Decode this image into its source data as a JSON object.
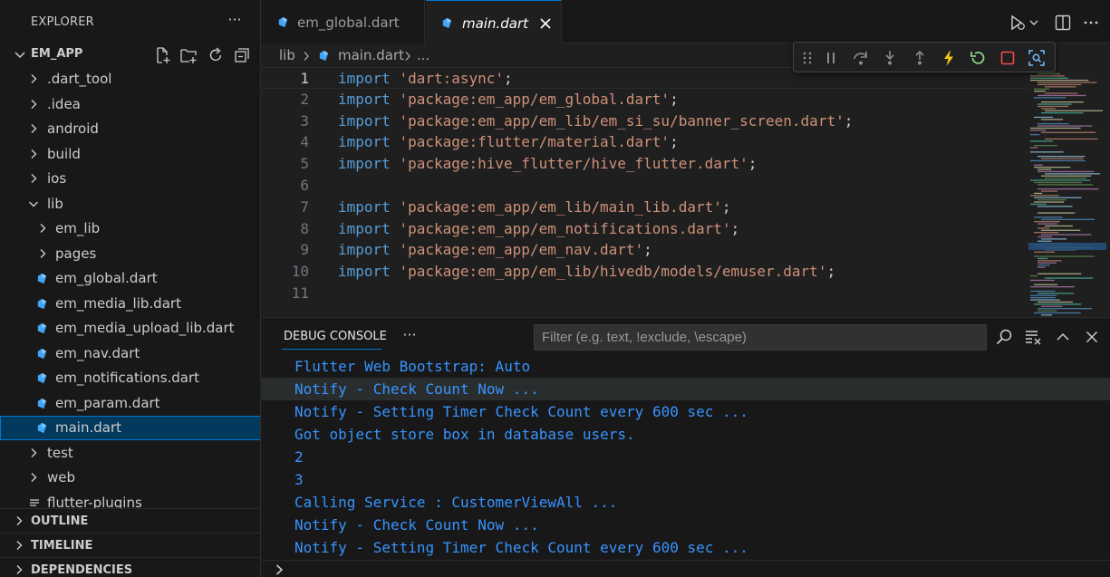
{
  "sidebar": {
    "title": "EXPLORER",
    "more": "···",
    "project": "EM_APP",
    "tree": [
      {
        "label": ".dart_tool",
        "kind": "folder",
        "expanded": false,
        "depth": 0
      },
      {
        "label": ".idea",
        "kind": "folder",
        "expanded": false,
        "depth": 0
      },
      {
        "label": "android",
        "kind": "folder",
        "expanded": false,
        "depth": 0
      },
      {
        "label": "build",
        "kind": "folder",
        "expanded": false,
        "depth": 0
      },
      {
        "label": "ios",
        "kind": "folder",
        "expanded": false,
        "depth": 0
      },
      {
        "label": "lib",
        "kind": "folder",
        "expanded": true,
        "depth": 0
      },
      {
        "label": "em_lib",
        "kind": "folder",
        "expanded": false,
        "depth": 1
      },
      {
        "label": "pages",
        "kind": "folder",
        "expanded": false,
        "depth": 1
      },
      {
        "label": "em_global.dart",
        "kind": "dart",
        "depth": 1
      },
      {
        "label": "em_media_lib.dart",
        "kind": "dart",
        "depth": 1
      },
      {
        "label": "em_media_upload_lib.dart",
        "kind": "dart",
        "depth": 1
      },
      {
        "label": "em_nav.dart",
        "kind": "dart",
        "depth": 1
      },
      {
        "label": "em_notifications.dart",
        "kind": "dart",
        "depth": 1
      },
      {
        "label": "em_param.dart",
        "kind": "dart",
        "depth": 1
      },
      {
        "label": "main.dart",
        "kind": "dart",
        "depth": 1,
        "selected": true
      },
      {
        "label": "test",
        "kind": "folder",
        "expanded": false,
        "depth": 0
      },
      {
        "label": "web",
        "kind": "folder",
        "expanded": false,
        "depth": 0
      },
      {
        "label": "flutter-plugins",
        "kind": "file",
        "depth": 0
      }
    ],
    "sections": [
      "OUTLINE",
      "TIMELINE",
      "DEPENDENCIES"
    ]
  },
  "tabs": [
    {
      "label": "em_global.dart",
      "active": false
    },
    {
      "label": "main.dart",
      "active": true
    }
  ],
  "breadcrumb": [
    "lib",
    "main.dart",
    "..."
  ],
  "editor": {
    "current_line": 1,
    "lines": [
      {
        "n": "1",
        "kw": "import",
        "str": "'dart:async'",
        "end": ";"
      },
      {
        "n": "2",
        "kw": "import",
        "str": "'package:em_app/em_global.dart'",
        "end": ";"
      },
      {
        "n": "3",
        "kw": "import",
        "str": "'package:em_app/em_lib/em_si_su/banner_screen.dart'",
        "end": ";"
      },
      {
        "n": "4",
        "kw": "import",
        "str": "'package:flutter/material.dart'",
        "end": ";"
      },
      {
        "n": "5",
        "kw": "import",
        "str": "'package:hive_flutter/hive_flutter.dart'",
        "end": ";"
      },
      {
        "n": "6",
        "kw": "",
        "str": "",
        "end": ""
      },
      {
        "n": "7",
        "kw": "import",
        "str": "'package:em_app/em_lib/main_lib.dart'",
        "end": ";"
      },
      {
        "n": "8",
        "kw": "import",
        "str": "'package:em_app/em_notifications.dart'",
        "end": ";"
      },
      {
        "n": "9",
        "kw": "import",
        "str": "'package:em_app/em_nav.dart'",
        "end": ";"
      },
      {
        "n": "10",
        "kw": "import",
        "str": "'package:em_app/em_lib/hivedb/models/emuser.dart'",
        "end": ";"
      },
      {
        "n": "11",
        "kw": "",
        "str": "",
        "end": ""
      }
    ]
  },
  "panel": {
    "tab": "DEBUG CONSOLE",
    "more": "···",
    "filter_placeholder": "Filter (e.g. text, !exclude, \\escape)",
    "lines": [
      "Flutter Web Bootstrap: Auto",
      "Notify - Check Count Now ...",
      "Notify - Setting Timer Check Count every 600 sec ...",
      "Got object store box in database users.",
      "2",
      "3",
      "Calling Service : CustomerViewAll ...",
      "Notify - Check Count Now ...",
      "Notify - Setting Timer Check Count every 600 sec ..."
    ],
    "highlight_line": 1
  },
  "colors": {
    "accent": "#0078d4",
    "keyword": "#569cd6",
    "string": "#ce9178",
    "console_text": "#3794ff",
    "dart_icon": "#42a5f5",
    "debug_continue": "#f5c518",
    "debug_restart": "#89d185",
    "debug_stop": "#f14c4c"
  }
}
